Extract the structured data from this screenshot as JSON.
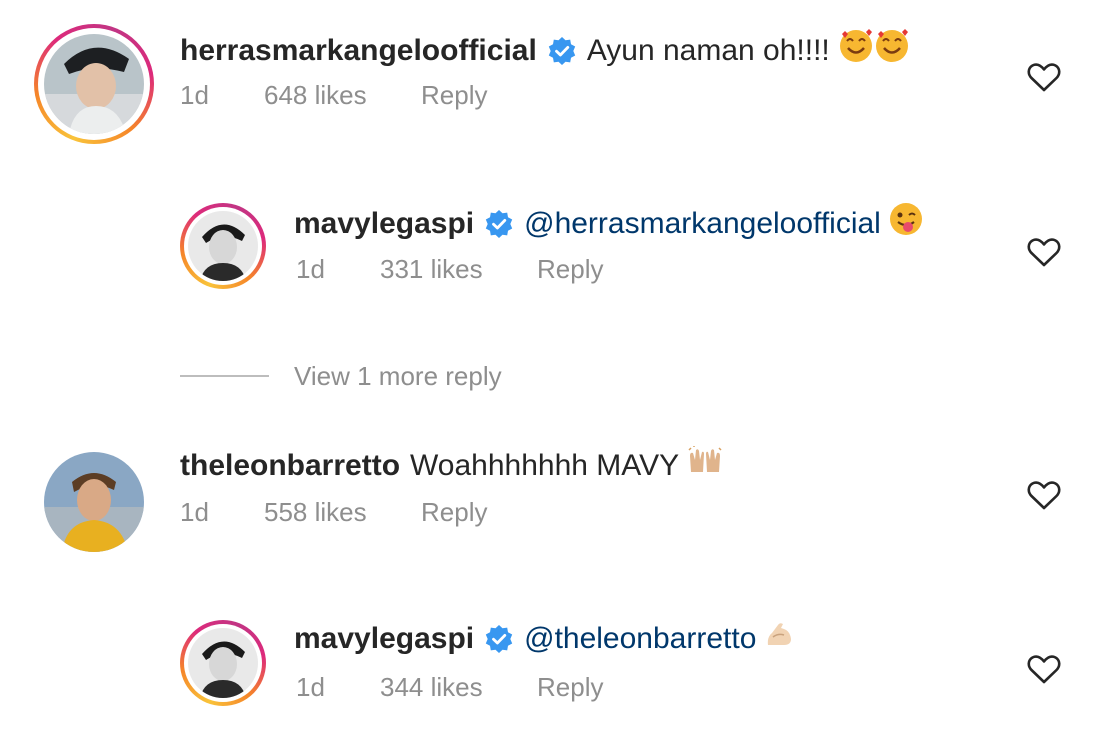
{
  "comments": [
    {
      "username": "herrasmarkangeloofficial",
      "verified": true,
      "text": "Ayun naman oh!!!!",
      "emoji": "smiling-face-with-hearts-emoji x2",
      "age": "1d",
      "likes": "648 likes",
      "reply_label": "Reply"
    },
    {
      "username": "mavylegaspi",
      "verified": true,
      "text": "@herrasmarkangeloofficial",
      "emoji": "winking-face-with-tongue-emoji",
      "age": "1d",
      "likes": "331 likes",
      "reply_label": "Reply"
    },
    {
      "username": "theleonbarretto",
      "verified": false,
      "text": "Woahhhhhhh MAVY",
      "emoji": "raising-hands-emoji",
      "age": "1d",
      "likes": "558 likes",
      "reply_label": "Reply"
    },
    {
      "username": "mavylegaspi",
      "verified": true,
      "text": "@theleonbarretto",
      "emoji": "flexed-biceps-emoji",
      "age": "1d",
      "likes": "344 likes",
      "reply_label": "Reply"
    }
  ],
  "view_more_replies": "View 1 more reply",
  "icons": {
    "verified": "verified-badge-icon",
    "like": "heart-outline-icon"
  },
  "colors": {
    "verified_blue": "#3897f0",
    "username": "#262626",
    "mention": "#00376b",
    "meta_gray": "#8e8e8e"
  }
}
